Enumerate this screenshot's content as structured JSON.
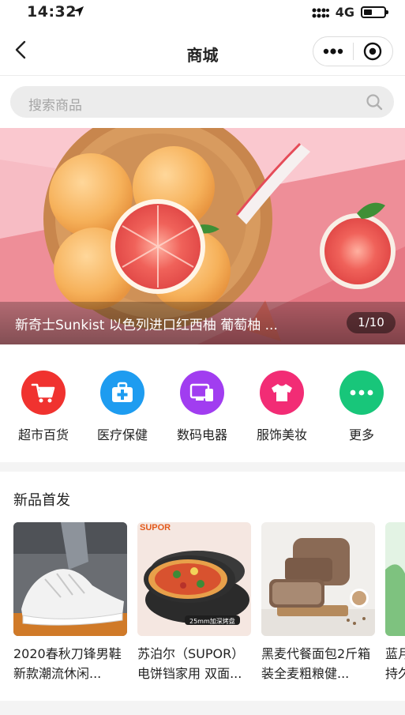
{
  "status_bar": {
    "time": "14:32",
    "network": "4G"
  },
  "nav": {
    "title": "商城"
  },
  "search": {
    "placeholder": "搜索商品"
  },
  "banner": {
    "title": "新奇士Sunkist 以色列进口红西柚 葡萄柚 ...",
    "indicator": "1/10"
  },
  "categories": [
    {
      "label": "超市百货",
      "icon": "shopping-cart-icon",
      "color": "#f0322f"
    },
    {
      "label": "医疗保健",
      "icon": "first-aid-kit-icon",
      "color": "#1e9cf0"
    },
    {
      "label": "数码电器",
      "icon": "devices-icon",
      "color": "#a13df0"
    },
    {
      "label": "服饰美妆",
      "icon": "shirt-icon",
      "color": "#f22c75"
    },
    {
      "label": "更多",
      "icon": "more-dots-icon",
      "color": "#18c67a"
    }
  ],
  "new_section": {
    "title": "新品首发",
    "products": [
      {
        "name": "2020春秋刀锋男鞋新款潮流休闲..."
      },
      {
        "name": "苏泊尔（SUPOR）电饼铛家用 双面...",
        "brand": "SUPOR",
        "tag": "25mm加深烤盘"
      },
      {
        "name": "黑麦代餐面包2斤箱装全麦粗粮健..."
      },
      {
        "name": "蓝月亮洗衣液清香型持久留香除菌除湿..."
      }
    ]
  }
}
